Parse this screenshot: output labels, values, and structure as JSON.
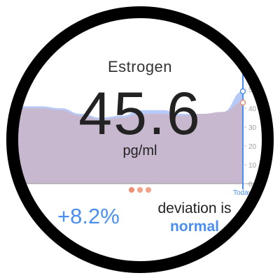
{
  "metric": {
    "name": "Estrogen",
    "value": "45.6",
    "unit": "pg/ml"
  },
  "pager": {
    "count": 3,
    "active_index": 0
  },
  "change": {
    "delta": "+8.2%"
  },
  "deviation": {
    "label": "deviation is",
    "status": "normal"
  },
  "colors": {
    "blue_accent": "#4a8ff0",
    "blue_area": "#b3c6f5",
    "salmon_area": "#f4b8a8",
    "overlap_area": "#bbb0d3",
    "dot": "#ec8f73",
    "bezel": "#000000"
  },
  "chart_data": {
    "type": "area",
    "ylim": [
      0,
      50
    ],
    "yticks": [
      "0",
      "10",
      "20",
      "30",
      "40",
      "50"
    ],
    "marker_label": "Today",
    "series": [
      {
        "values": [
          38,
          41,
          41,
          40,
          37,
          35,
          36,
          39,
          39,
          37,
          37,
          38,
          49
        ]
      },
      {
        "values": [
          39,
          40,
          40,
          39,
          36,
          34,
          35,
          37,
          37,
          36,
          37,
          38,
          43
        ]
      }
    ]
  }
}
